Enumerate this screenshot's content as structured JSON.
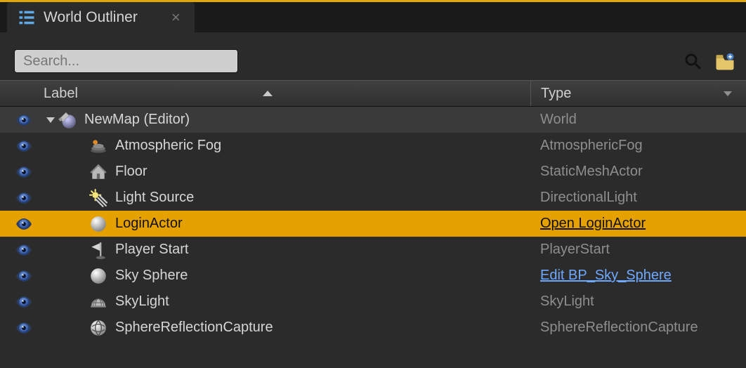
{
  "tab": {
    "title": "World Outliner"
  },
  "search": {
    "placeholder": "Search..."
  },
  "columns": {
    "label": "Label",
    "type": "Type"
  },
  "rows": [
    {
      "icon": "world",
      "indent": 0,
      "expandable": true,
      "label": "NewMap (Editor)",
      "type": "World",
      "selected": false,
      "parent": true,
      "typeLink": false
    },
    {
      "icon": "fog",
      "indent": 1,
      "expandable": false,
      "label": "Atmospheric Fog",
      "type": "AtmosphericFog",
      "selected": false,
      "parent": false,
      "typeLink": false
    },
    {
      "icon": "house",
      "indent": 1,
      "expandable": false,
      "label": "Floor",
      "type": "StaticMeshActor",
      "selected": false,
      "parent": false,
      "typeLink": false
    },
    {
      "icon": "light",
      "indent": 1,
      "expandable": false,
      "label": "Light Source",
      "type": "DirectionalLight",
      "selected": false,
      "parent": false,
      "typeLink": false
    },
    {
      "icon": "sphere",
      "indent": 1,
      "expandable": false,
      "label": "LoginActor",
      "type": "Open LoginActor",
      "selected": true,
      "parent": false,
      "typeLink": false
    },
    {
      "icon": "flag",
      "indent": 1,
      "expandable": false,
      "label": "Player Start",
      "type": "PlayerStart",
      "selected": false,
      "parent": false,
      "typeLink": false
    },
    {
      "icon": "sphere",
      "indent": 1,
      "expandable": false,
      "label": "Sky Sphere",
      "type": "Edit BP_Sky_Sphere",
      "selected": false,
      "parent": false,
      "typeLink": true
    },
    {
      "icon": "dome",
      "indent": 1,
      "expandable": false,
      "label": "SkyLight",
      "type": "SkyLight",
      "selected": false,
      "parent": false,
      "typeLink": false
    },
    {
      "icon": "reflect",
      "indent": 1,
      "expandable": false,
      "label": "SphereReflectionCapture",
      "type": "SphereReflectionCapture",
      "selected": false,
      "parent": false,
      "typeLink": false
    }
  ]
}
